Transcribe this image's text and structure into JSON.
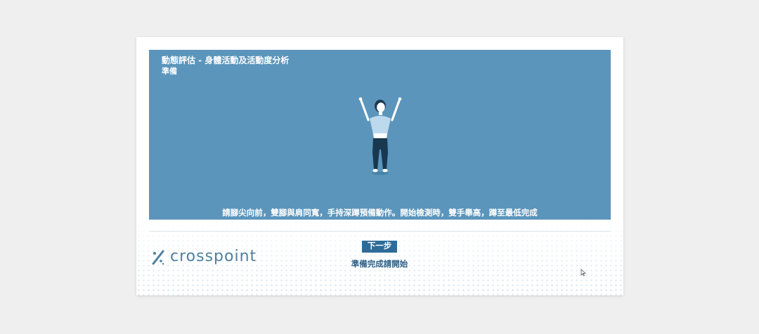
{
  "stage": {
    "title": "動態評估 - 身體活動及活動度分析",
    "subtitle": "準備",
    "instruction": "請腳尖向前，雙腳與肩同寬，手持深蹲預備動作。開始檢測時，雙手舉高，蹲至最低完成",
    "figure_icon": "person-arms-raised-icon",
    "background_color": "#5b95bb"
  },
  "footer": {
    "logo_text": "crosspoint",
    "next_button_label": "下一步",
    "ready_text": "準備完成請開始",
    "accent_color": "#2d6c98"
  }
}
